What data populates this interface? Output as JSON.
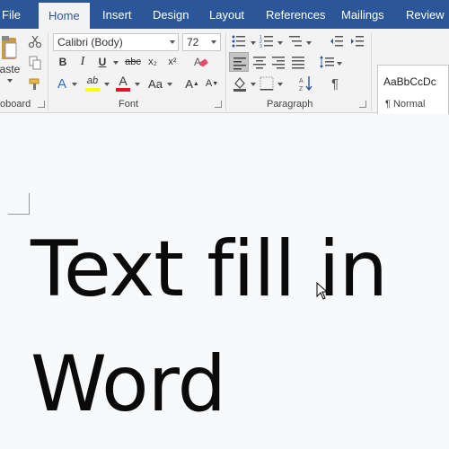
{
  "tabs": [
    {
      "label": "File"
    },
    {
      "label": "Home"
    },
    {
      "label": "Insert"
    },
    {
      "label": "Design"
    },
    {
      "label": "Layout"
    },
    {
      "label": "References"
    },
    {
      "label": "Mailings"
    },
    {
      "label": "Review"
    }
  ],
  "ribbon": {
    "clipboard": {
      "label": "oboard",
      "paste_label": "aste"
    },
    "font": {
      "label": "Font",
      "font_name": "Calibri (Body)",
      "font_size": "72",
      "bold": "B",
      "italic": "I",
      "underline": "U",
      "strikethrough": "abc",
      "subscript": "x₂",
      "superscript": "x²",
      "text_effects": "A",
      "highlight": "ab",
      "font_color": "A",
      "change_case": "Aa",
      "grow": "A",
      "shrink": "A"
    },
    "paragraph": {
      "label": "Paragraph"
    },
    "styles": {
      "sample": "AaBbCcDc",
      "name": "¶ Normal"
    }
  },
  "document": {
    "lines": [
      "Text fill in",
      "Word"
    ]
  },
  "colors": {
    "accent": "#2b579a",
    "highlight_swatch": "#ffff00",
    "font_color_swatch": "#e81123"
  },
  "icons": [
    "cut-icon",
    "copy-icon",
    "format-painter-icon",
    "bullets-icon",
    "numbering-icon",
    "multilevel-list-icon",
    "decrease-indent-icon",
    "increase-indent-icon",
    "align-left-icon",
    "center-icon",
    "align-right-icon",
    "justify-icon",
    "line-spacing-icon",
    "shading-icon",
    "borders-icon",
    "sort-icon",
    "show-marks-icon",
    "clear-formatting-icon",
    "mouse-pointer-icon"
  ]
}
